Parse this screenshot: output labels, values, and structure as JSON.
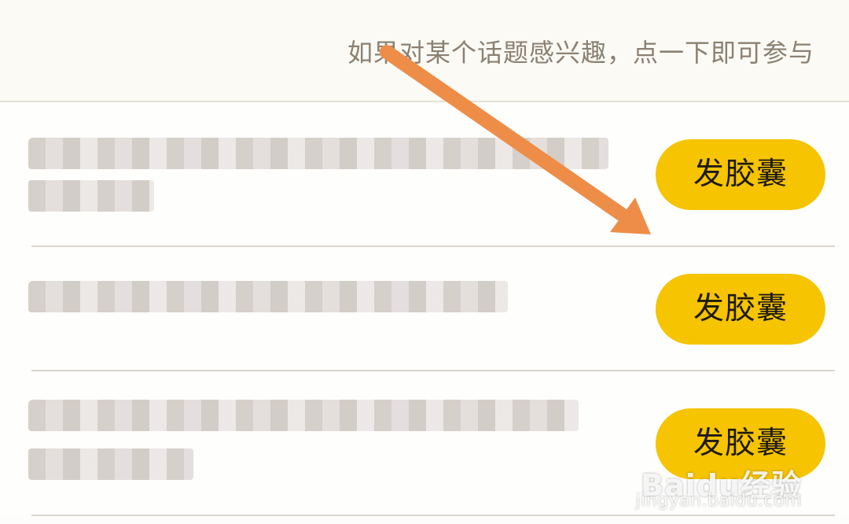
{
  "header": {
    "hint_text": "如果对某个话题感兴趣，点一下即可参与"
  },
  "topics": [
    {
      "action_label": "发胶囊"
    },
    {
      "action_label": "发胶囊"
    },
    {
      "action_label": "发胶囊"
    }
  ],
  "watermark": {
    "logo_text": "Baidu经验",
    "url_text": "jingyan.baidu.com"
  },
  "colors": {
    "button": "#f6c400",
    "arrow": "#ee8d47",
    "hint_text": "#8b8072",
    "divider": "#d9d6cc",
    "background": "#fdfdfb"
  }
}
